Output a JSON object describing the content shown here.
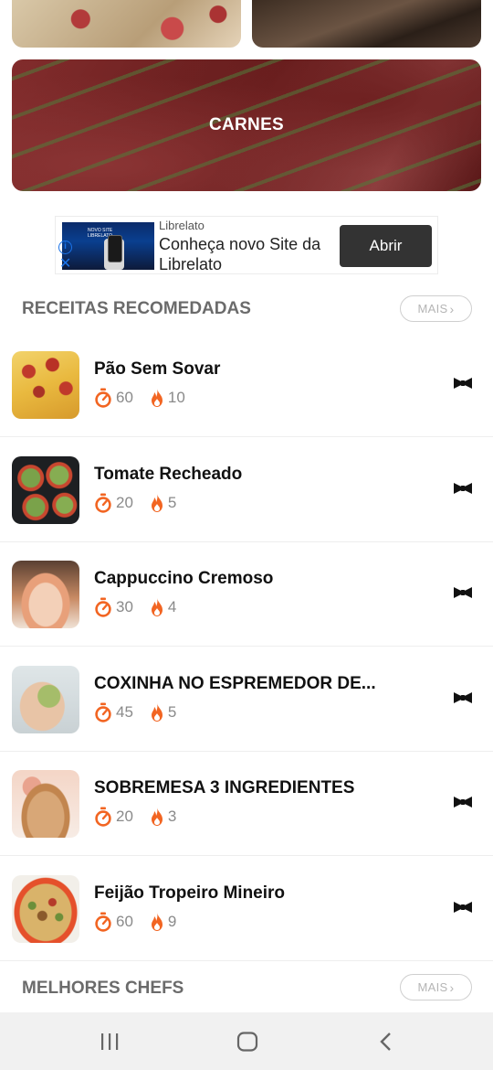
{
  "categories": {
    "top_left": "",
    "top_right": "",
    "featured": "CARNES"
  },
  "ad": {
    "advertiser": "Librelato",
    "headline": "Conheça novo Site da Librelato",
    "cta": "Abrir",
    "info_icon": "info-icon",
    "close_icon": "close-icon"
  },
  "recommended": {
    "title": "RECEITAS RECOMEDADAS",
    "more_label": "MAIS",
    "items": [
      {
        "title": "Pão Sem Sovar",
        "time": "60",
        "calories": "10"
      },
      {
        "title": "Tomate Recheado",
        "time": "20",
        "calories": "5"
      },
      {
        "title": "Cappuccino Cremoso",
        "time": "30",
        "calories": "4"
      },
      {
        "title": "COXINHA NO ESPREMEDOR DE...",
        "time": "45",
        "calories": "5"
      },
      {
        "title": "SOBREMESA 3 INGREDIENTES",
        "time": "20",
        "calories": "3"
      },
      {
        "title": "Feijão Tropeiro Mineiro",
        "time": "60",
        "calories": "9"
      }
    ]
  },
  "chefs": {
    "title": "MELHORES CHEFS",
    "more_label": "MAIS"
  },
  "colors": {
    "accent_orange": "#f26522",
    "section_gray": "#6b6b6b",
    "navbar_bg": "#f1f1f1"
  },
  "navbar": {
    "recents_icon": "recents-icon",
    "home_icon": "home-icon",
    "back_icon": "back-icon"
  }
}
